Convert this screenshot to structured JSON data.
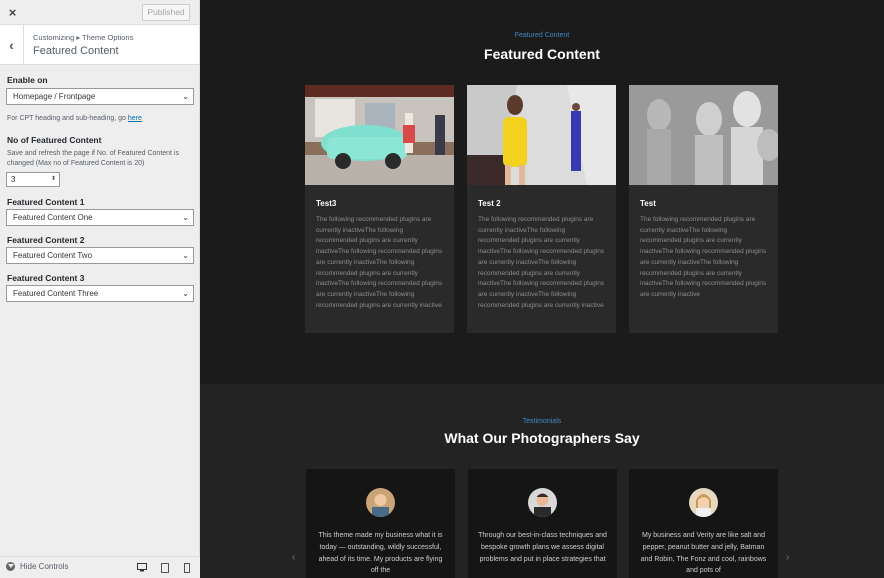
{
  "sidebar": {
    "close_icon": "×",
    "published_label": "Published",
    "breadcrumb": "Customizing ▸ Theme Options",
    "section_title": "Featured Content",
    "enable_on_label": "Enable on",
    "enable_on_value": "Homepage / Frontpage",
    "cpt_note": "For CPT heading and sub-heading, go",
    "cpt_link": "here",
    "num_label": "No of Featured Content",
    "num_desc": "Save and refresh the page if No. of Featured Content is changed (Max no of Featured Content is 20)",
    "num_value": "3",
    "fc1_label": "Featured Content 1",
    "fc1_value": "Featured Content One",
    "fc2_label": "Featured Content 2",
    "fc2_value": "Featured Content Two",
    "fc3_label": "Featured Content 3",
    "fc3_value": "Featured Content Three",
    "hide_controls": "Hide Controls"
  },
  "featured": {
    "eyebrow": "Featured Content",
    "title": "Featured Content",
    "cards": [
      {
        "title": "Test3",
        "text": "The following recommended plugins are currently inactiveThe following recommended plugins are currently inactiveThe following recommended plugins are currently inactiveThe following recommended plugins are currently inactiveThe following recommended plugins are currently inactiveThe following recommended plugins are currently inactive"
      },
      {
        "title": "Test 2",
        "text": "The following recommended plugins are currently inactiveThe following recommended plugins are currently inactiveThe following recommended plugins are currently inactiveThe following recommended plugins are currently inactiveThe following recommended plugins are currently inactiveThe following recommended plugins are currently inactive"
      },
      {
        "title": "Test",
        "text": "The following recommended plugins are currently inactiveThe following recommended plugins are currently inactiveThe following recommended plugins are currently inactiveThe following recommended plugins are currently inactiveThe following recommended plugins are currently inactive"
      }
    ]
  },
  "testimonials": {
    "eyebrow": "Testimonials",
    "title": "What Our Photographers Say",
    "items": [
      {
        "text": "This theme made my business what it is today — outstanding, wildly successful, ahead of its time. My products are flying off the"
      },
      {
        "text": "Through our best-in-class techniques and bespoke growth plans we assess digital problems and put in place strategies that"
      },
      {
        "text": "My business and Verity are like salt and pepper, peanut butter and jelly, Batman and Robin, The Fonz and cool, rainbows and pots of"
      }
    ]
  },
  "colors": {
    "accent": "#3f88c5",
    "dark_bg": "#1b1b1b",
    "card_bg": "#2a2a2a"
  }
}
